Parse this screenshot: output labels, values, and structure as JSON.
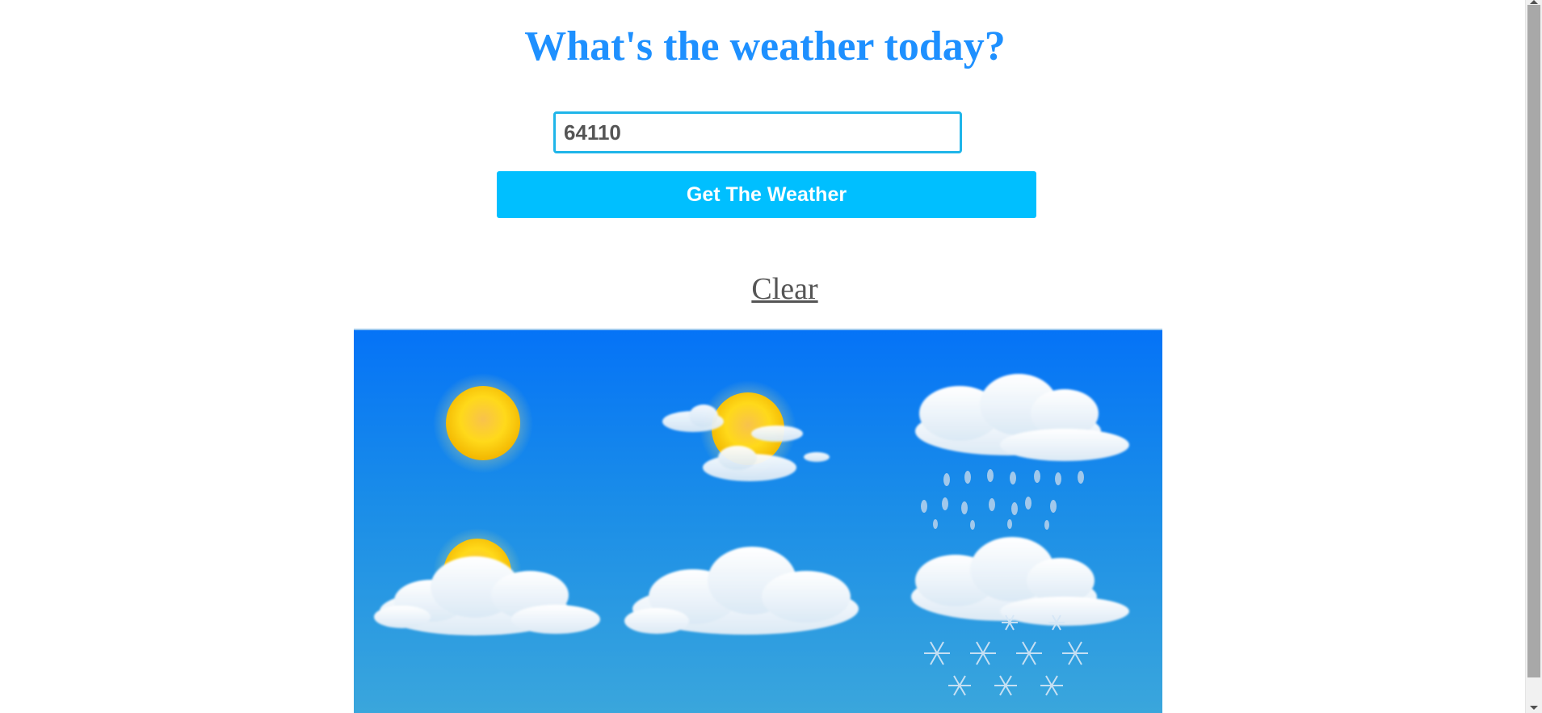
{
  "page": {
    "title": "What's the weather today?"
  },
  "search": {
    "value": "64110",
    "button_label": "Get The Weather"
  },
  "clear": {
    "label": "Clear"
  },
  "banner": {
    "icons": [
      "sunny-icon",
      "partly-sunny-icon",
      "rain-icon",
      "sun-behind-cloud-icon",
      "cloudy-icon",
      "snow-icon"
    ]
  },
  "colors": {
    "title": "#1e90ff",
    "button": "#00bfff",
    "input_border": "#1fb5e9",
    "clear_link": "#555555"
  }
}
